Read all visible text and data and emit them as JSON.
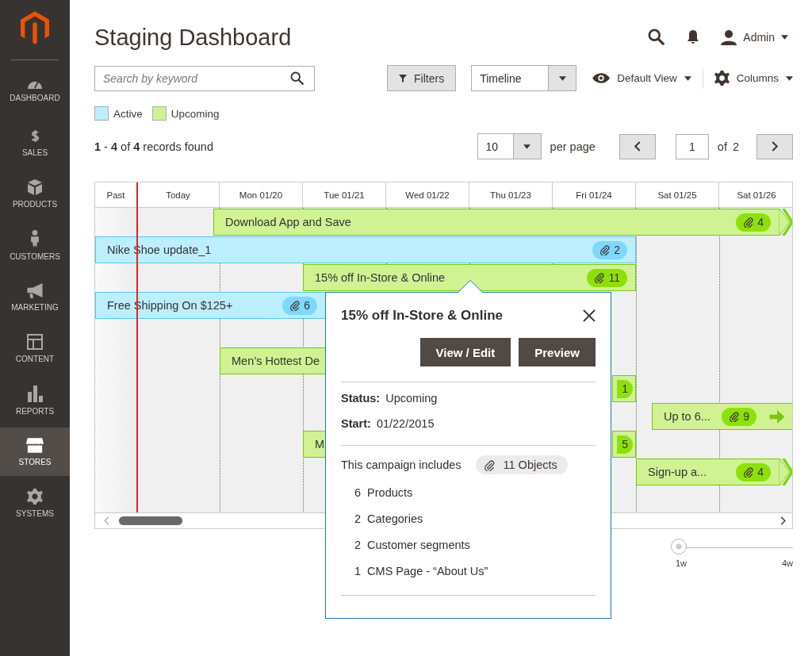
{
  "sidebar": {
    "items": [
      {
        "label": "DASHBOARD",
        "selected": false
      },
      {
        "label": "SALES",
        "selected": false
      },
      {
        "label": "PRODUCTS",
        "selected": false
      },
      {
        "label": "CUSTOMERS",
        "selected": false
      },
      {
        "label": "MARKETING",
        "selected": false
      },
      {
        "label": "CONTENT",
        "selected": false
      },
      {
        "label": "REPORTS",
        "selected": false
      },
      {
        "label": "STORES",
        "selected": true
      },
      {
        "label": "SYSTEMS",
        "selected": false
      }
    ]
  },
  "header": {
    "title": "Staging Dashboard",
    "user": "Admin"
  },
  "toolbar": {
    "search": {
      "placeholder": "Search by keyword"
    },
    "filters": "Filters",
    "view_mode": "Timeline",
    "default_view": "Default View",
    "columns": "Columns"
  },
  "legend": [
    {
      "label": "Active",
      "color": "#bdeefd"
    },
    {
      "label": "Upcoming",
      "color": "#d0f293"
    }
  ],
  "records": {
    "text": "**1** - **4** of **4** records found"
  },
  "pagination": {
    "per_page": "10",
    "per_page_label": "per page",
    "page": "1",
    "of": "of",
    "total": "2"
  },
  "timeline": {
    "columns": [
      "Past",
      "Today",
      "Mon 01/20",
      "Tue 01/21",
      "Wed 01/22",
      "Thu 01/23",
      "Fri 01/24",
      "Sat 01/25",
      "Sat 01/26"
    ],
    "bars": [
      {
        "label": "Download App and Save",
        "color": "#d0f293",
        "count": "4",
        "kind": "chevron"
      },
      {
        "label": "Nike Shoe update_1",
        "color": "#bdeefd",
        "count": "2",
        "kind": "plain"
      },
      {
        "label": "15% off In-Store & Online",
        "color": "#d0f293",
        "count": "11",
        "kind": "plain"
      },
      {
        "label": "Free Shipping On $125+",
        "color": "#bdeefd",
        "count": "6",
        "kind": "plain"
      },
      {
        "label": "Men’s Hottest De",
        "color": "#d0f293",
        "kind": "plain"
      },
      {
        "color": "#d0f293",
        "count": "1",
        "kind": "plain"
      },
      {
        "label": "Up to 6...",
        "color": "#d0f293",
        "count": "9",
        "kind": "arrow"
      },
      {
        "label": "M",
        "color": "#d0f293",
        "kind": "plain"
      },
      {
        "color": "#d0f293",
        "count": "5",
        "kind": "plain"
      },
      {
        "label": "Sign-up a...",
        "color": "#d0f293",
        "count": "4",
        "kind": "chevron"
      }
    ]
  },
  "zoom": {
    "level": 0,
    "min_label": "1w",
    "max_label": "4w"
  },
  "popover": {
    "title": "15% off In-Store & Online",
    "buttons": [
      "View / Edit",
      "Preview"
    ],
    "status_label": "Status:",
    "status": "Upcoming",
    "start_label": "Start:",
    "start": "01/22/2015",
    "includes": "This campaign includes",
    "objects": "11 Objects",
    "items": [
      {
        "count": "6",
        "label": "Products"
      },
      {
        "count": "2",
        "label": "Categories"
      },
      {
        "count": "2",
        "label": "Customer segments"
      },
      {
        "count": "1",
        "label": "CMS Page - “About Us”"
      }
    ]
  }
}
